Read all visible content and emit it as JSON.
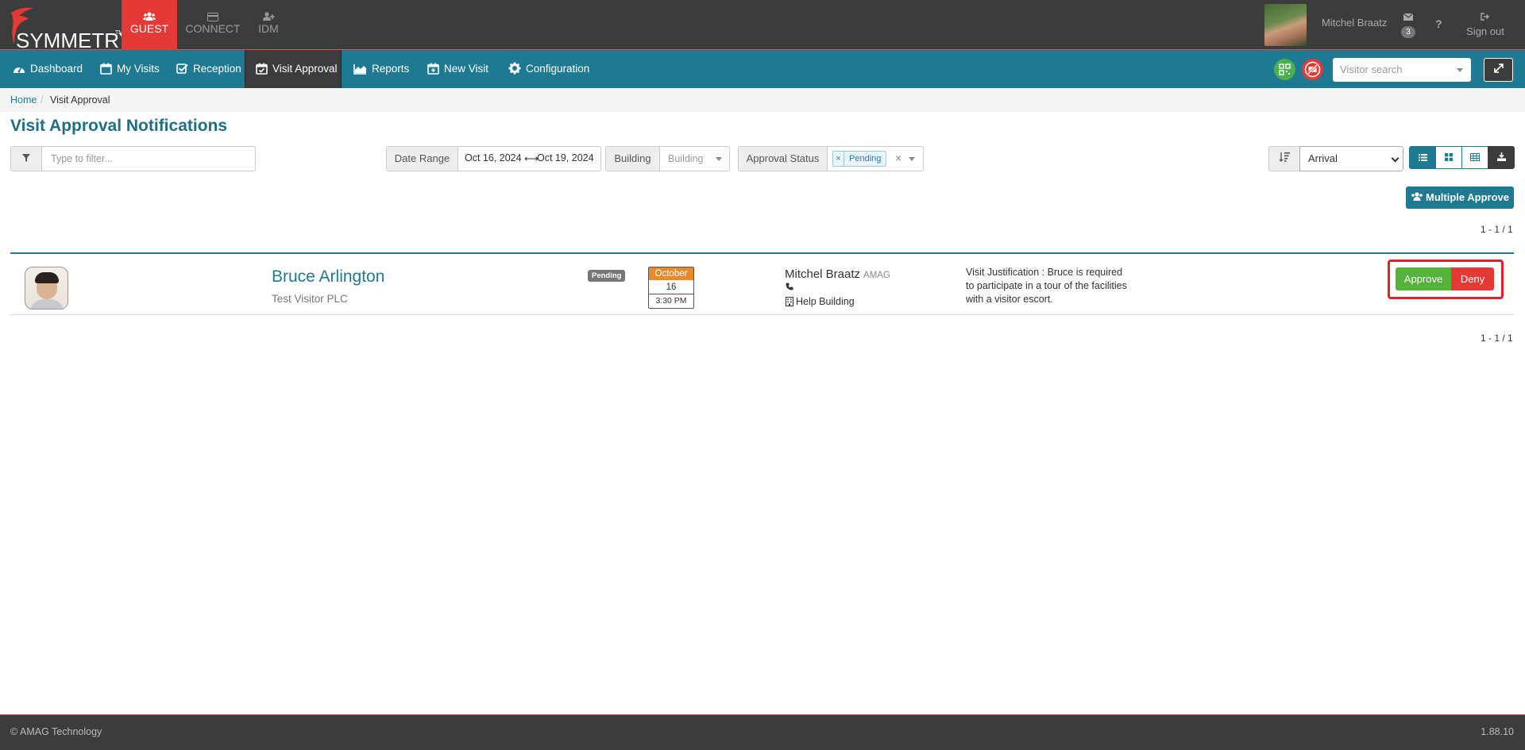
{
  "brand": {
    "name": "SYMMETRY",
    "tm": "TM"
  },
  "app_tabs": [
    {
      "label": "GUEST",
      "icon": "users-icon",
      "active": true
    },
    {
      "label": "CONNECT",
      "icon": "card-icon",
      "active": false
    },
    {
      "label": "IDM",
      "icon": "user-plus-icon",
      "active": false
    }
  ],
  "user": {
    "name": "Mitchel Braatz",
    "messages_count": "3",
    "help_label": "?",
    "signout_label": "Sign out"
  },
  "nav": {
    "items": [
      {
        "label": "Dashboard",
        "icon": "dashboard-icon",
        "active": false
      },
      {
        "label": "My Visits",
        "icon": "calendar-icon",
        "active": false
      },
      {
        "label": "Reception",
        "icon": "check-square-icon",
        "active": false
      },
      {
        "label": "Visit Approval",
        "icon": "calendar-check-icon",
        "active": true
      },
      {
        "label": "Reports",
        "icon": "area-chart-icon",
        "active": false
      },
      {
        "label": "New Visit",
        "icon": "calendar-plus-icon",
        "active": false
      },
      {
        "label": "Configuration",
        "icon": "gear-icon",
        "active": false
      }
    ],
    "search_placeholder": "Visitor search",
    "colors": {
      "qr_status": "#4caf50",
      "blocked_status": "#e53935"
    }
  },
  "breadcrumb": {
    "home": "Home",
    "separator": "/",
    "current": "Visit Approval"
  },
  "page": {
    "title": "Visit Approval Notifications"
  },
  "filters": {
    "text_placeholder": "Type to filter...",
    "date_range": {
      "label": "Date Range",
      "start": "Oct 16, 2024",
      "arrow": "⟷",
      "end": "Oct 19, 2024"
    },
    "building": {
      "label": "Building",
      "placeholder": "Building"
    },
    "approval_status": {
      "label": "Approval Status",
      "tag_remove": "×",
      "tag": "Pending",
      "clear": "×"
    },
    "sort": {
      "selected": "Arrival"
    }
  },
  "actions": {
    "multiple_approve": "Multiple Approve"
  },
  "pagination": {
    "top": "1 - 1 / 1",
    "bottom": "1 - 1 / 1"
  },
  "visits": [
    {
      "visitor_name": "Bruce Arlington",
      "company": "Test Visitor PLC",
      "status": "Pending",
      "month": "October",
      "day": "16",
      "time": "3:30 PM",
      "host_name": "Mitchel Braatz",
      "host_org": "AMAG",
      "building": "Help Building",
      "justification": "Visit Justification : Bruce is required to participate in a tour of the facilities with a visitor escort.",
      "approve_label": "Approve",
      "deny_label": "Deny"
    }
  ],
  "footer": {
    "copyright": "© AMAG Technology",
    "version": "1.88.10"
  }
}
